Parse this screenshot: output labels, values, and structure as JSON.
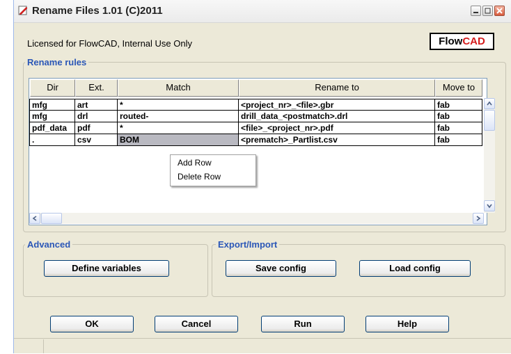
{
  "window": {
    "title": "Rename Files 1.01 (C)2011"
  },
  "license_text": "Licensed for FlowCAD, Internal Use Only",
  "logo": {
    "part1": "Flow",
    "part2": "CAD",
    "accent": "#d51c1c"
  },
  "rename_rules": {
    "label": "Rename rules",
    "columns": [
      "Dir",
      "Ext.",
      "Match",
      "Rename to",
      "Move to"
    ],
    "rows": [
      [
        "mfg",
        "art",
        "*",
        "<project_nr>_<file>.gbr",
        "fab"
      ],
      [
        "mfg",
        "drl",
        "routed-",
        "drill_data_<postmatch>.drl",
        "fab"
      ],
      [
        "pdf_data",
        "pdf",
        "*",
        "<file>_<project_nr>.pdf",
        "fab"
      ],
      [
        ".",
        "csv",
        "BOM",
        "<prematch>_Partlist.csv",
        "fab"
      ]
    ],
    "selected_cell": "BOM"
  },
  "context_menu": {
    "items": [
      "Add Row",
      "Delete Row"
    ]
  },
  "advanced": {
    "label": "Advanced",
    "define_variables": "Define variables"
  },
  "export_import": {
    "label": "Export/Import",
    "save_config": "Save config",
    "load_config": "Load config"
  },
  "footer_buttons": {
    "ok": "OK",
    "cancel": "Cancel",
    "run": "Run",
    "help": "Help"
  },
  "colors": {
    "group_label": "#2b57b7",
    "selection": "#b9b9c1"
  }
}
